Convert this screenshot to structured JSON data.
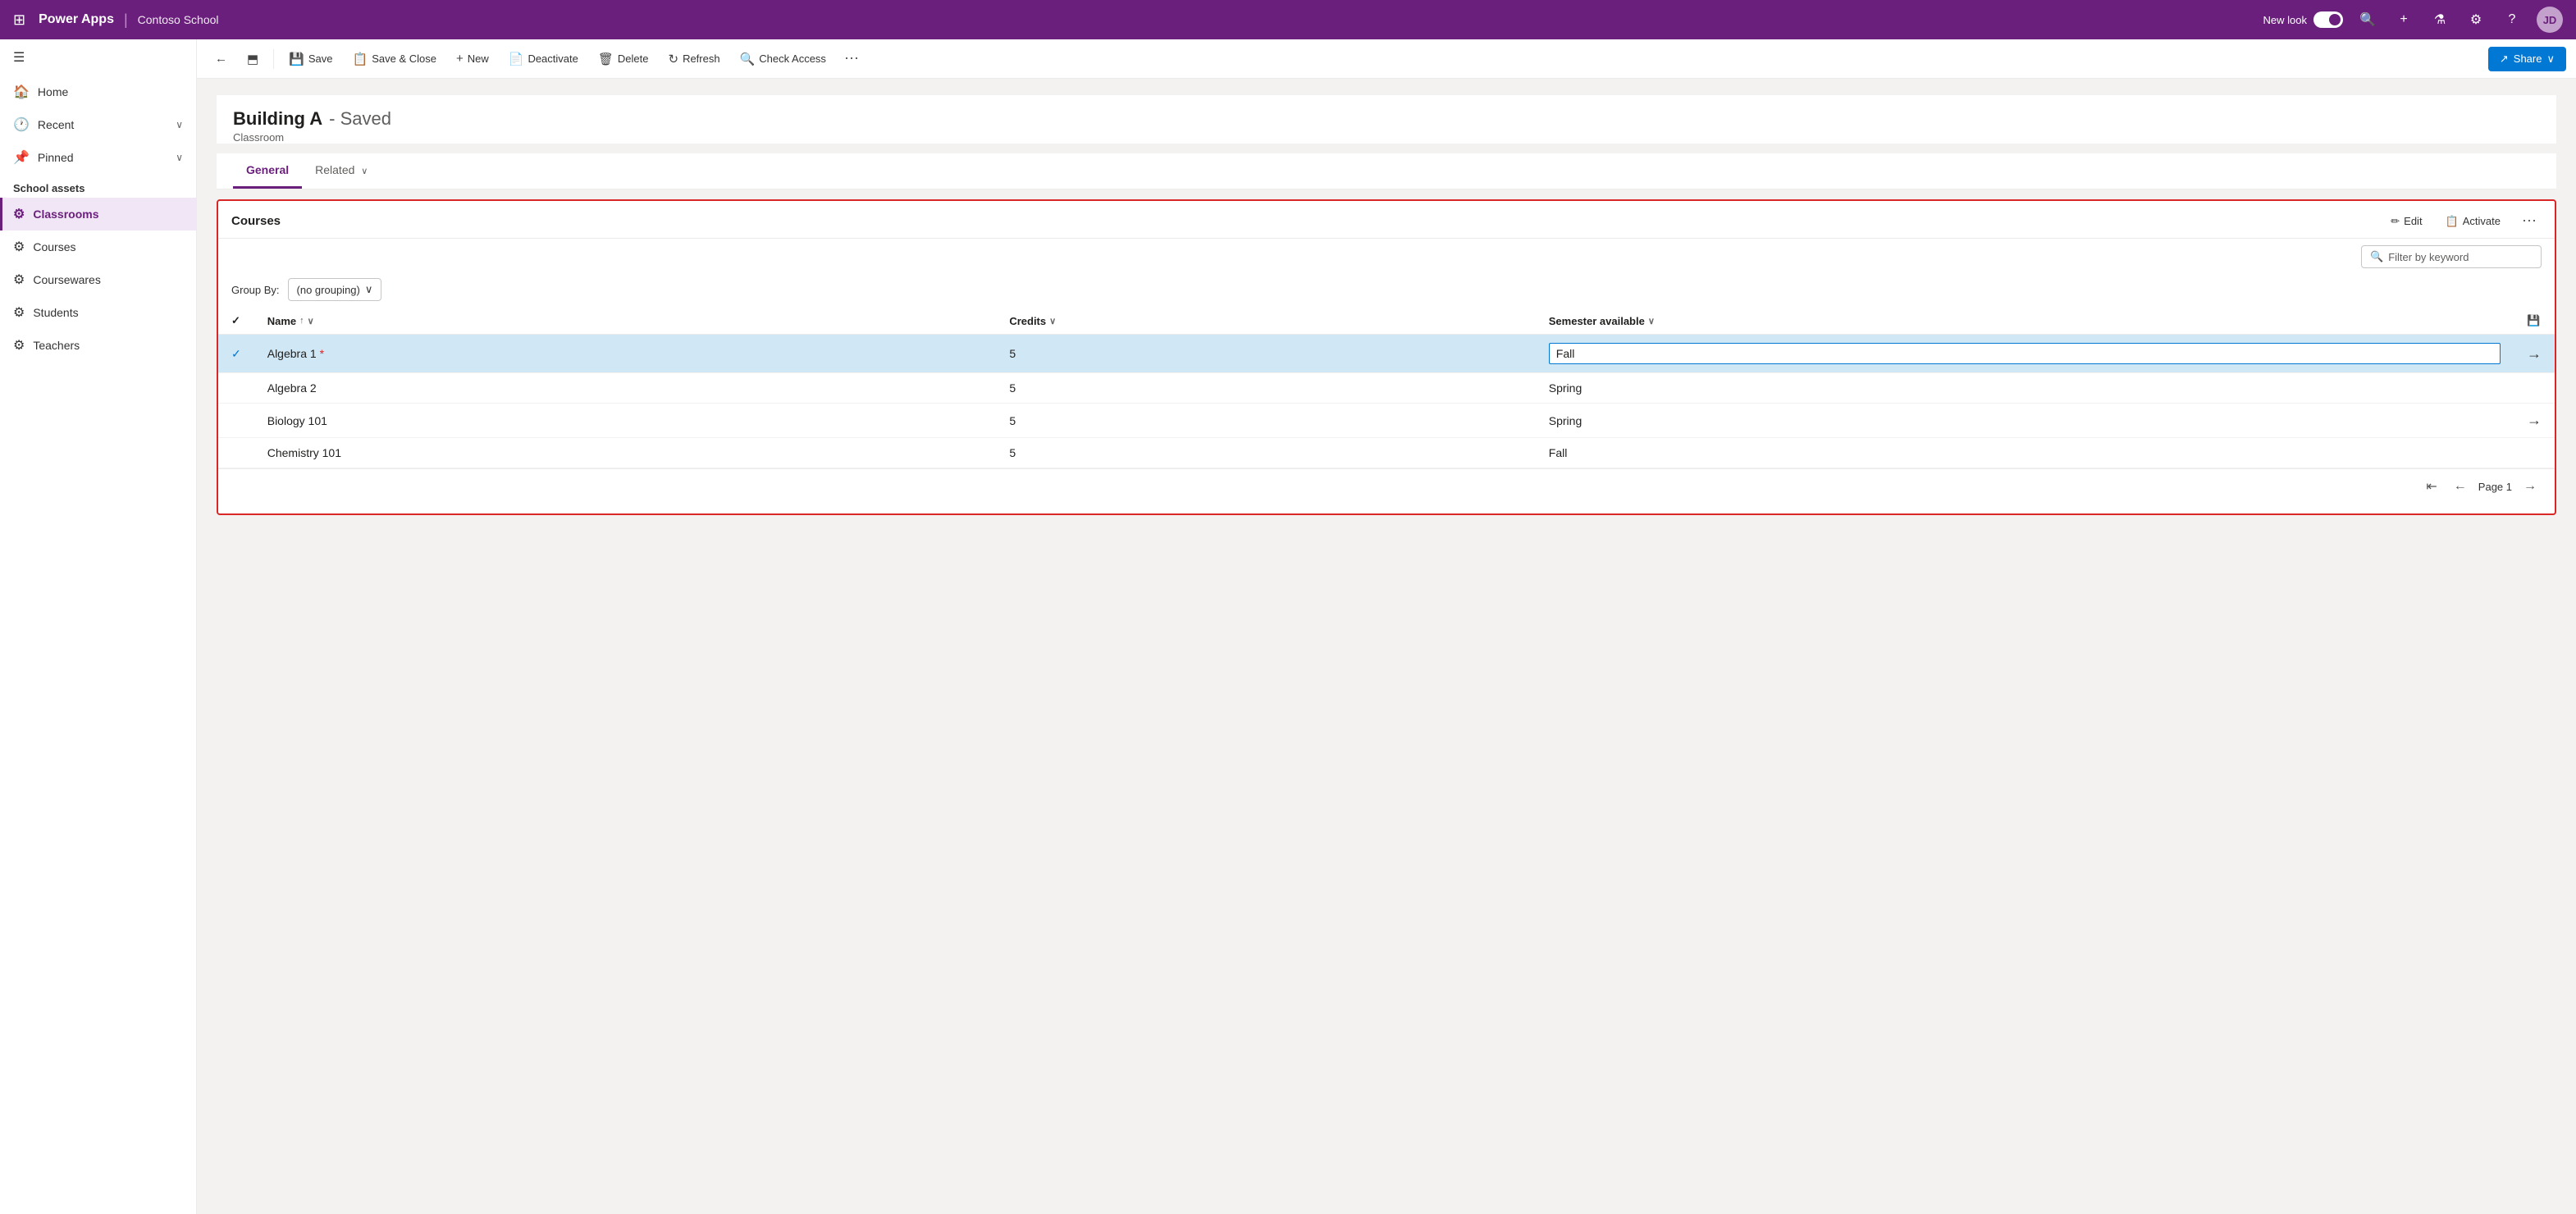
{
  "topbar": {
    "waffle_icon": "⊞",
    "app_name": "Power Apps",
    "divider": "|",
    "env_name": "Contoso School",
    "new_look_label": "New look",
    "search_icon": "🔍",
    "add_icon": "+",
    "filter_icon": "⚗",
    "settings_icon": "⚙",
    "help_icon": "?",
    "avatar_initials": "JD"
  },
  "sidebar": {
    "hamburger": "☰",
    "nav_items": [
      {
        "id": "home",
        "icon": "🏠",
        "label": "Home"
      },
      {
        "id": "recent",
        "icon": "🕐",
        "label": "Recent",
        "chevron": "∨"
      },
      {
        "id": "pinned",
        "icon": "📌",
        "label": "Pinned",
        "chevron": "∨"
      }
    ],
    "section_title": "School assets",
    "school_items": [
      {
        "id": "classrooms",
        "icon": "⚙",
        "label": "Classrooms",
        "active": true
      },
      {
        "id": "courses",
        "icon": "⚙",
        "label": "Courses",
        "active": false
      },
      {
        "id": "coursewares",
        "icon": "⚙",
        "label": "Coursewares",
        "active": false
      },
      {
        "id": "students",
        "icon": "⚙",
        "label": "Students",
        "active": false
      },
      {
        "id": "teachers",
        "icon": "⚙",
        "label": "Teachers",
        "active": false
      }
    ]
  },
  "command_bar": {
    "back_icon": "←",
    "tab_icon": "⬒",
    "save_label": "Save",
    "save_icon": "💾",
    "save_close_label": "Save & Close",
    "save_close_icon": "📋",
    "new_label": "New",
    "new_icon": "+",
    "deactivate_label": "Deactivate",
    "deactivate_icon": "📄",
    "delete_label": "Delete",
    "delete_icon": "🗑",
    "refresh_label": "Refresh",
    "refresh_icon": "↻",
    "check_access_label": "Check Access",
    "check_access_icon": "🔍",
    "more_icon": "⋯",
    "share_label": "Share",
    "share_icon": "↗",
    "share_chevron": "∨"
  },
  "record": {
    "title": "Building A",
    "saved_suffix": "- Saved",
    "record_type": "Classroom",
    "tab_general_label": "General",
    "tab_related_label": "Related",
    "tab_related_chevron": "∨"
  },
  "courses_section": {
    "title": "Courses",
    "edit_icon": "✏",
    "edit_label": "Edit",
    "activate_icon": "📋",
    "activate_label": "Activate",
    "more_icon": "⋯",
    "filter_placeholder": "Filter by keyword",
    "filter_icon": "🔍",
    "groupby_label": "Group By:",
    "groupby_value": "(no grouping)",
    "groupby_chevron": "∨",
    "col_check": "",
    "col_name": "Name",
    "col_name_sort": "↑",
    "col_name_sort_dir": "∨",
    "col_credits": "Credits",
    "col_credits_sort": "∨",
    "col_semester": "Semester available",
    "col_semester_sort": "∨",
    "save_icon": "💾",
    "rows": [
      {
        "id": "algebra1",
        "selected": true,
        "name": "Algebra 1",
        "red_star": true,
        "credits": "5",
        "semester": "Fall",
        "semester_edit": true,
        "nav_arrow": "→"
      },
      {
        "id": "algebra2",
        "selected": false,
        "name": "Algebra 2",
        "red_star": false,
        "credits": "5",
        "semester": "Spring",
        "semester_edit": false,
        "nav_arrow": ""
      },
      {
        "id": "biology101",
        "selected": false,
        "name": "Biology 101",
        "red_star": false,
        "credits": "5",
        "semester": "Spring",
        "semester_edit": false,
        "nav_arrow": "→"
      },
      {
        "id": "chemistry101",
        "selected": false,
        "name": "Chemistry 101",
        "red_star": false,
        "credits": "5",
        "semester": "Fall",
        "semester_edit": false,
        "nav_arrow": ""
      }
    ]
  },
  "pagination": {
    "first_icon": "⇤",
    "prev_icon": "←",
    "page_label": "Page 1",
    "next_icon": "→"
  }
}
